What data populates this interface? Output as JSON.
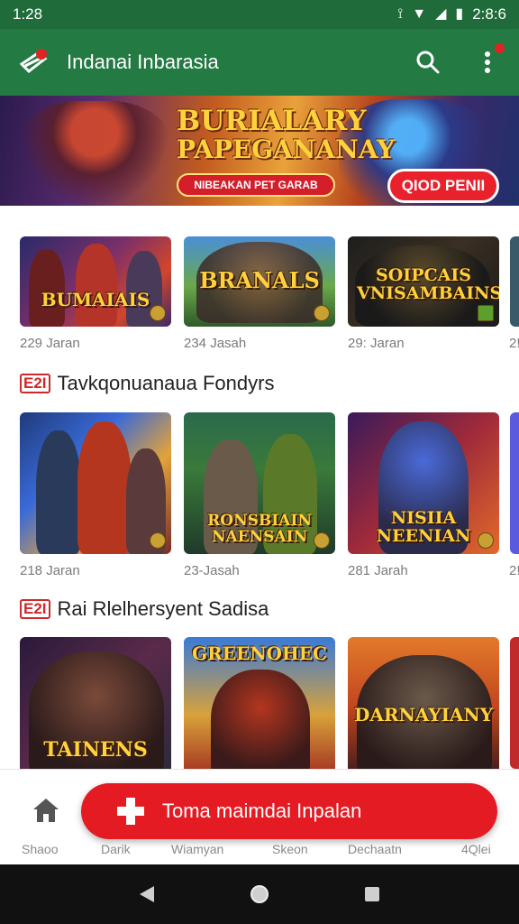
{
  "status_bar": {
    "time": "1:28",
    "clock_right": "2:8:6",
    "icons": [
      "vibrate-icon",
      "wifi-icon",
      "signal-icon",
      "battery-icon"
    ]
  },
  "app_bar": {
    "title": "Indanai Inbarasia",
    "logo_icon": "brand-logo-icon",
    "actions": [
      "search-icon",
      "more-vert-icon"
    ],
    "color": "#247a43"
  },
  "banner": {
    "headline_line1": "BURIALARY",
    "headline_line2": "PAPEGANANAY",
    "tag": "NIBEAKAN PET GARAB",
    "cta": "QIOD PENII"
  },
  "row1": [
    {
      "title": "BUMAIAIS",
      "meta": "229 Jaran"
    },
    {
      "title": "BRANALS",
      "meta": "234 Jasah"
    },
    {
      "title": "SOIPCAIS VNISAMBAINS",
      "meta": "29: Jaran"
    }
  ],
  "row1_peek_meta": "2!",
  "section1": {
    "icon": "E2I",
    "title": "Tavkqonuanaua Fondyrs"
  },
  "row2": [
    {
      "title": "",
      "meta": "218 Jaran"
    },
    {
      "title": "RONSBIAIN NAENSAIN",
      "meta": "23-Jasah"
    },
    {
      "title": "NISIIA NEENIAN",
      "meta": "281 Jarah"
    }
  ],
  "row2_peek_meta": "2!",
  "section2": {
    "icon": "E2I",
    "title": "Rai Rlelhersyent Sadisa"
  },
  "row3": [
    {
      "title": "TAINENS"
    },
    {
      "title": "GREENOHEC"
    },
    {
      "title": "DARNAYIANY"
    }
  ],
  "fab": {
    "label": "Toma maimdai Inpalan",
    "icon": "add-plus-icon"
  },
  "bottom_nav": [
    {
      "label": "Shaoo",
      "icon": "home-icon"
    },
    {
      "label": "Darik"
    },
    {
      "label": "Wiamyan"
    },
    {
      "label": "Skeon"
    },
    {
      "label": "Dechaatn"
    },
    {
      "label": "4Qlei"
    }
  ],
  "colors": {
    "accent_red": "#e51b23",
    "app_green": "#247a43"
  }
}
